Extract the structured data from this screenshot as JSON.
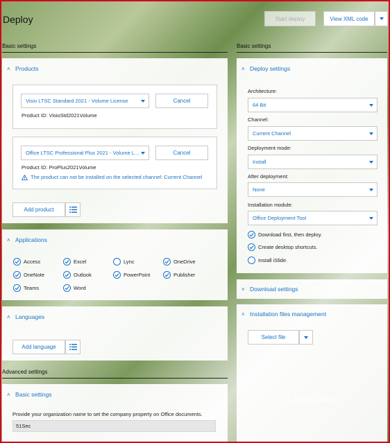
{
  "window": {
    "title": "Deploy"
  },
  "toolbar": {
    "start_label": "Start deploy",
    "xml_label": "View XML code"
  },
  "left": {
    "section_label": "Basic settings",
    "products": {
      "title": "Products",
      "items": [
        {
          "value": "Visio LTSC Standard 2021 - Volume License",
          "cancel": "Cancel",
          "product_id": "Product ID:  VisioStd2021Volume"
        },
        {
          "value": "Office LTSC Professional Plus 2021 - Volume L...",
          "cancel": "Cancel",
          "product_id": "Product ID:  ProPlus2021Volume",
          "warning": "The product can not be installed on the selected channel: Current Channel"
        }
      ],
      "add_label": "Add product"
    },
    "applications": {
      "title": "Applications",
      "items": [
        {
          "label": "Access",
          "checked": true
        },
        {
          "label": "Excel",
          "checked": true
        },
        {
          "label": "Lync",
          "checked": false
        },
        {
          "label": "OneDrive",
          "checked": true
        },
        {
          "label": "OneNote",
          "checked": true
        },
        {
          "label": "Outlook",
          "checked": true
        },
        {
          "label": "PowerPoint",
          "checked": true
        },
        {
          "label": "Publisher",
          "checked": true
        },
        {
          "label": "Teams",
          "checked": true
        },
        {
          "label": "Word",
          "checked": true
        }
      ]
    },
    "languages": {
      "title": "Languages",
      "add_label": "Add language"
    },
    "advanced_label": "Advanced settings",
    "adv_basic": {
      "title": "Basic settings",
      "org_prompt": "Provide your organization name to set the company property on Office documents.",
      "org_value": "51Sec"
    }
  },
  "right": {
    "section_label": "Basic settings",
    "deploy": {
      "title": "Deploy settings",
      "architecture_label": "Architecture:",
      "architecture": "64 Bit",
      "channel_label": "Channel:",
      "channel": "Current Channel",
      "mode_label": "Deployment mode:",
      "mode": "Install",
      "after_label": "After deployment:",
      "after": "None",
      "module_label": "Installation module:",
      "module": "Office Deployment Tool",
      "checks": [
        {
          "label": "Download first, then deploy.",
          "checked": true
        },
        {
          "label": "Create desktop shortcuts.",
          "checked": true
        },
        {
          "label": "Install iSlide.",
          "checked": false
        }
      ]
    },
    "download": {
      "title": "Download settings"
    },
    "files": {
      "title": "Installation files management",
      "select_label": "Select file"
    }
  },
  "watermark": "51SEC.ORG",
  "colors": {
    "accent": "#1a73c7",
    "frame": "#d0001c"
  }
}
